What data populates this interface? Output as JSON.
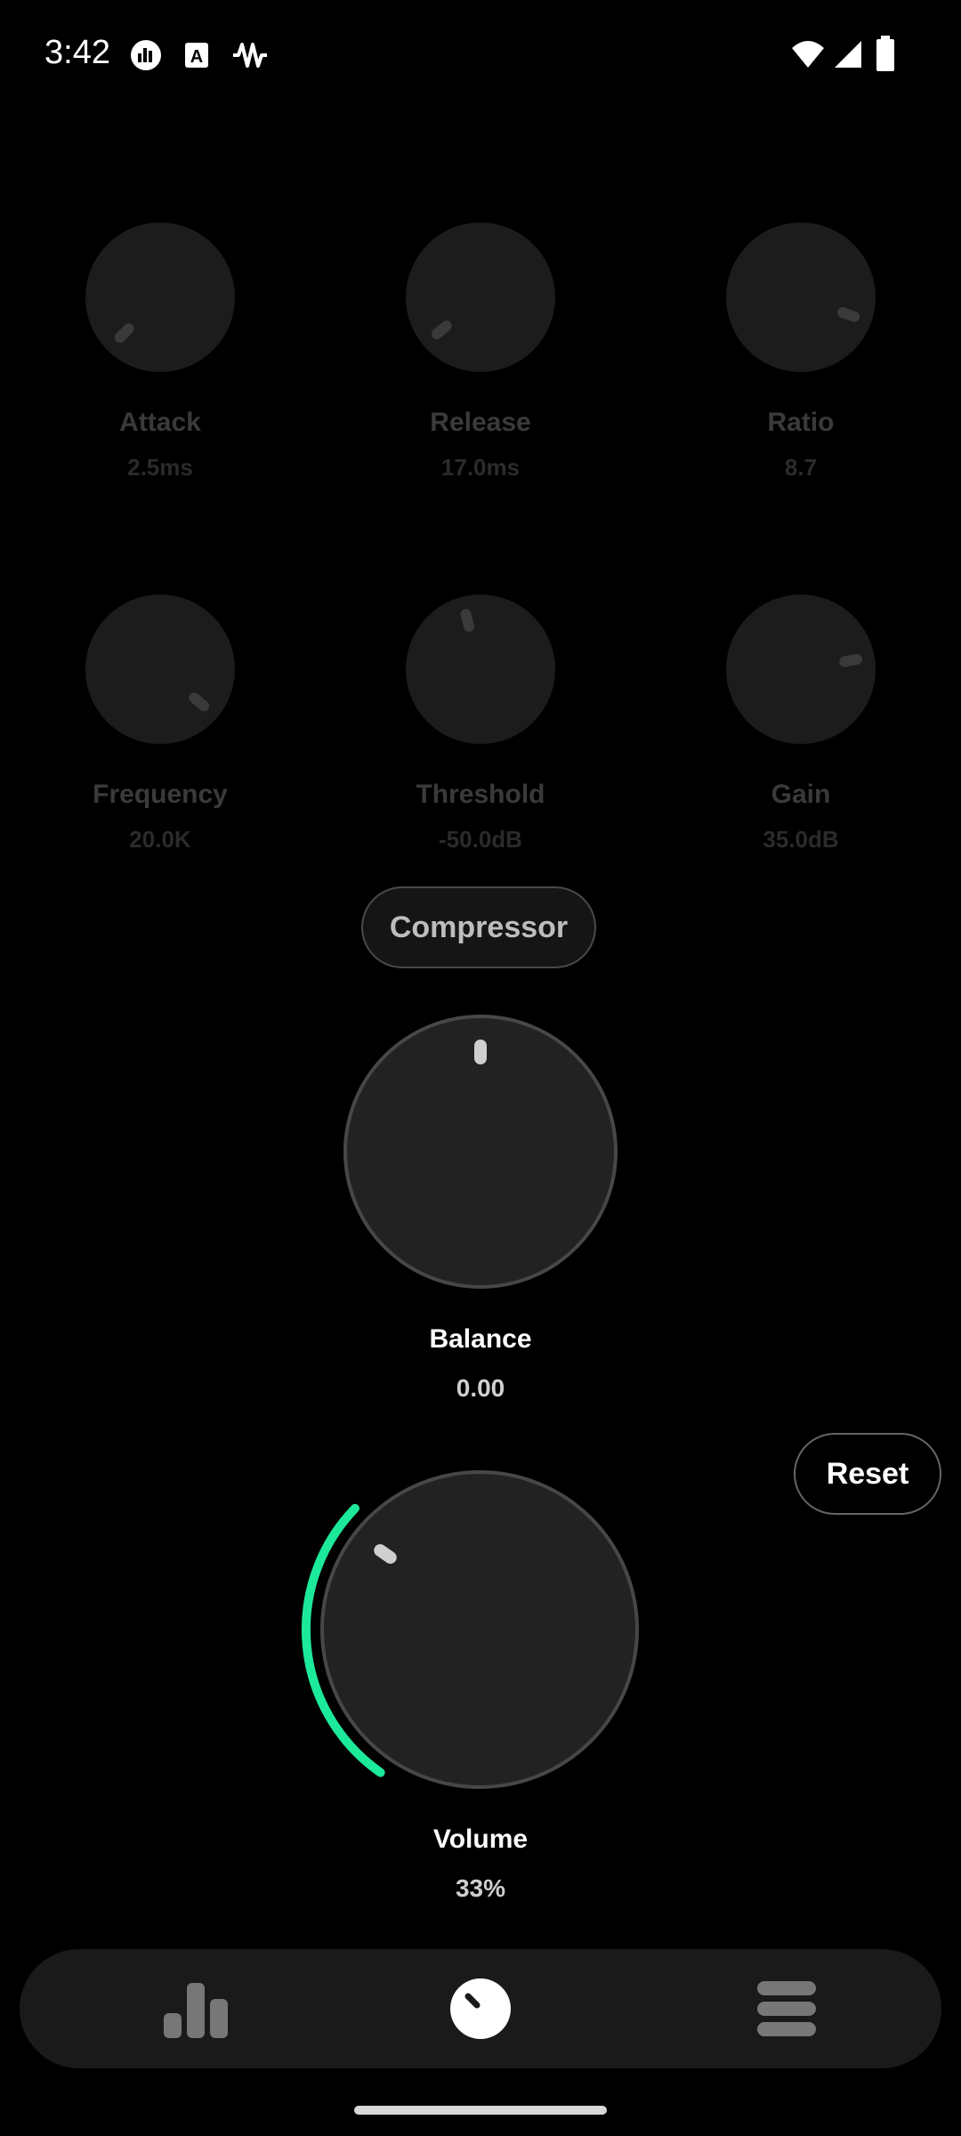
{
  "status_bar": {
    "time": "3:42",
    "notification_icons": [
      "equalizer-app-icon",
      "text-a-icon",
      "waveform-icon"
    ],
    "system_icons": [
      "wifi-icon",
      "signal-icon",
      "battery-icon"
    ]
  },
  "knobs": [
    {
      "label": "Attack",
      "value": "2.5ms"
    },
    {
      "label": "Release",
      "value": "17.0ms"
    },
    {
      "label": "Ratio",
      "value": "8.7"
    },
    {
      "label": "Frequency",
      "value": "20.0K"
    },
    {
      "label": "Threshold",
      "value": "-50.0dB"
    },
    {
      "label": "Gain",
      "value": "35.0dB"
    }
  ],
  "compressor_button": "Compressor",
  "balance": {
    "label": "Balance",
    "value": "0.00"
  },
  "reset_button": "Reset",
  "volume": {
    "label": "Volume",
    "value": "33%",
    "level_fraction": 0.33,
    "accent": "#1de99b"
  },
  "bottom_nav": {
    "items": [
      "equalizer-bars-icon",
      "knob-icon",
      "stacked-menu-icon"
    ],
    "active": "knob-icon"
  }
}
